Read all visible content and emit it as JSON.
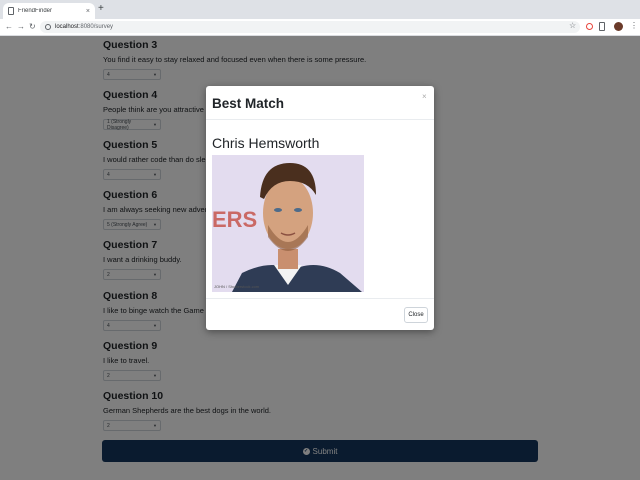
{
  "browser": {
    "tab_title": "FriendFinder",
    "tab_close": "×",
    "new_tab": "+",
    "url_host": "localhost",
    "url_path": ":8080/survey"
  },
  "survey": {
    "questions": [
      {
        "title": "Question 3",
        "text": "You find it easy to stay relaxed and focused even when there is some pressure.",
        "selected": "4"
      },
      {
        "title": "Question 4",
        "text": "People think are you attractive",
        "selected": "1 (Strongly Disagree)"
      },
      {
        "title": "Question 5",
        "text": "I would rather code than do sleep.",
        "selected": "4"
      },
      {
        "title": "Question 6",
        "text": "I am always seeking new adventures.",
        "selected": "5 (Strongly Agree)"
      },
      {
        "title": "Question 7",
        "text": "I want a drinking buddy.",
        "selected": "2"
      },
      {
        "title": "Question 8",
        "text": "I like to binge watch the Game of Thrones.",
        "selected": "4"
      },
      {
        "title": "Question 9",
        "text": "I like to travel.",
        "selected": "2"
      },
      {
        "title": "Question 10",
        "text": "German Shepherds are the best dogs in the world.",
        "selected": "2"
      }
    ],
    "submit_label": "Submit"
  },
  "modal": {
    "title": "Best Match",
    "close_x": "×",
    "match_name": "Chris Hemsworth",
    "photo_watermark": "JOHN / Shutterstock.com",
    "close_label": "Close"
  },
  "colors": {
    "submit_bg": "#14375e",
    "overlay": "rgba(0,0,0,0.5)"
  }
}
